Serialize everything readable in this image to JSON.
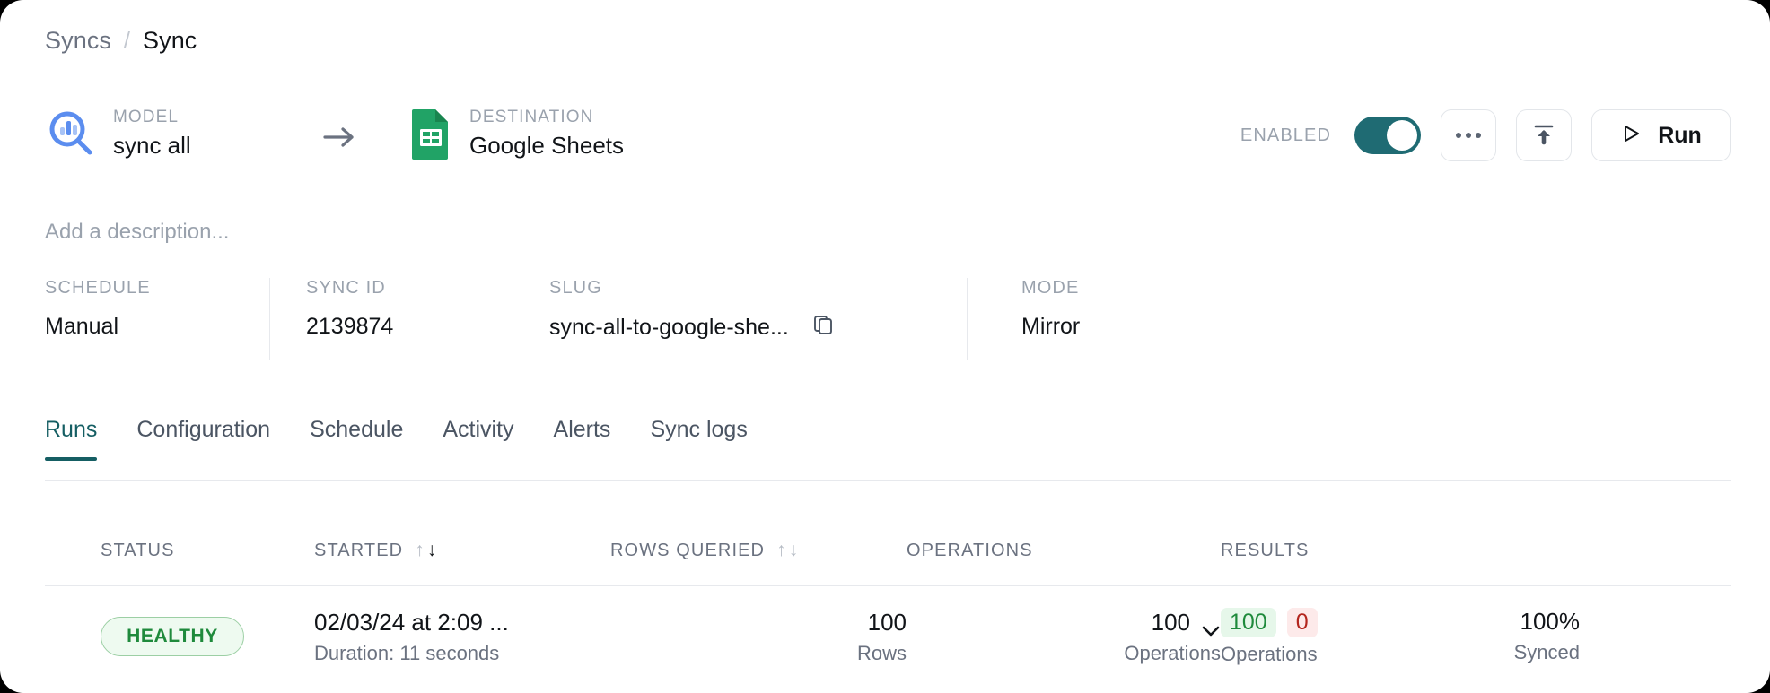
{
  "breadcrumb": {
    "parent": "Syncs",
    "separator": "/",
    "current": "Sync"
  },
  "header": {
    "model": {
      "label": "MODEL",
      "value": "sync all",
      "icon": "model-search-icon"
    },
    "destination": {
      "label": "DESTINATION",
      "value": "Google Sheets",
      "icon": "google-sheets-icon"
    },
    "enabled_label": "ENABLED",
    "enabled": true,
    "more_label": "…",
    "run_label": "Run",
    "toggle_color": "#1f6b73"
  },
  "description_placeholder": "Add a description...",
  "meta": [
    {
      "label": "SCHEDULE",
      "value": "Manual"
    },
    {
      "label": "SYNC ID",
      "value": "2139874"
    },
    {
      "label": "SLUG",
      "value": "sync-all-to-google-she..."
    },
    {
      "label": "MODE",
      "value": "Mirror"
    }
  ],
  "tabs": [
    {
      "label": "Runs",
      "active": true
    },
    {
      "label": "Configuration",
      "active": false
    },
    {
      "label": "Schedule",
      "active": false
    },
    {
      "label": "Activity",
      "active": false
    },
    {
      "label": "Alerts",
      "active": false
    },
    {
      "label": "Sync logs",
      "active": false
    }
  ],
  "table": {
    "headers": {
      "status": "STATUS",
      "started": "STARTED",
      "rows_queried": "ROWS QUERIED",
      "operations": "OPERATIONS",
      "results": "RESULTS"
    },
    "sort": {
      "up": "↑",
      "down": "↓"
    },
    "rows": [
      {
        "status": "HEALTHY",
        "started_primary": "02/03/24 at 2:09 ...",
        "started_sub": "Duration: 11 seconds",
        "rows_value": "100",
        "rows_sub": "Rows",
        "ops_value": "100",
        "ops_sub": "Operations",
        "results_ok": "100",
        "results_err": "0",
        "results_sub": "Operations",
        "synced_value": "100%",
        "synced_sub": "Synced"
      }
    ]
  },
  "colors": {
    "accent_teal": "#155e63",
    "success_green": "#1f8a3c",
    "error_red": "#b3261e",
    "sheets_green": "#21a366",
    "model_blue": "#5b8def"
  }
}
